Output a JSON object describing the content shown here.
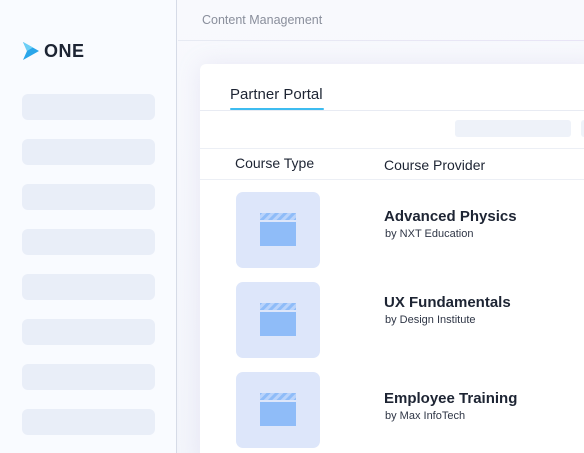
{
  "brand": {
    "name": "ONE",
    "accent": "#2aa6ea"
  },
  "sidebar": {
    "item_count": 8
  },
  "header": {
    "breadcrumb": "Content Management"
  },
  "tabs": [
    {
      "label": "Partner Portal",
      "active": true
    }
  ],
  "table": {
    "columns": [
      "Course Type",
      "Course Provider"
    ],
    "rows": [
      {
        "icon": "video-clapperboard-icon",
        "title": "Advanced Physics",
        "provider": "by NXT Education"
      },
      {
        "icon": "video-clapperboard-icon",
        "title": "UX Fundamentals",
        "provider": "by Design Institute"
      },
      {
        "icon": "video-clapperboard-icon",
        "title": "Employee Training",
        "provider": "by Max InfoTech"
      }
    ]
  },
  "colors": {
    "tab_underline": "#3dbcf0",
    "thumb_bg": "#dde6fa",
    "icon_fill": "#8fbcf8",
    "skeleton": "#e9eef8"
  }
}
